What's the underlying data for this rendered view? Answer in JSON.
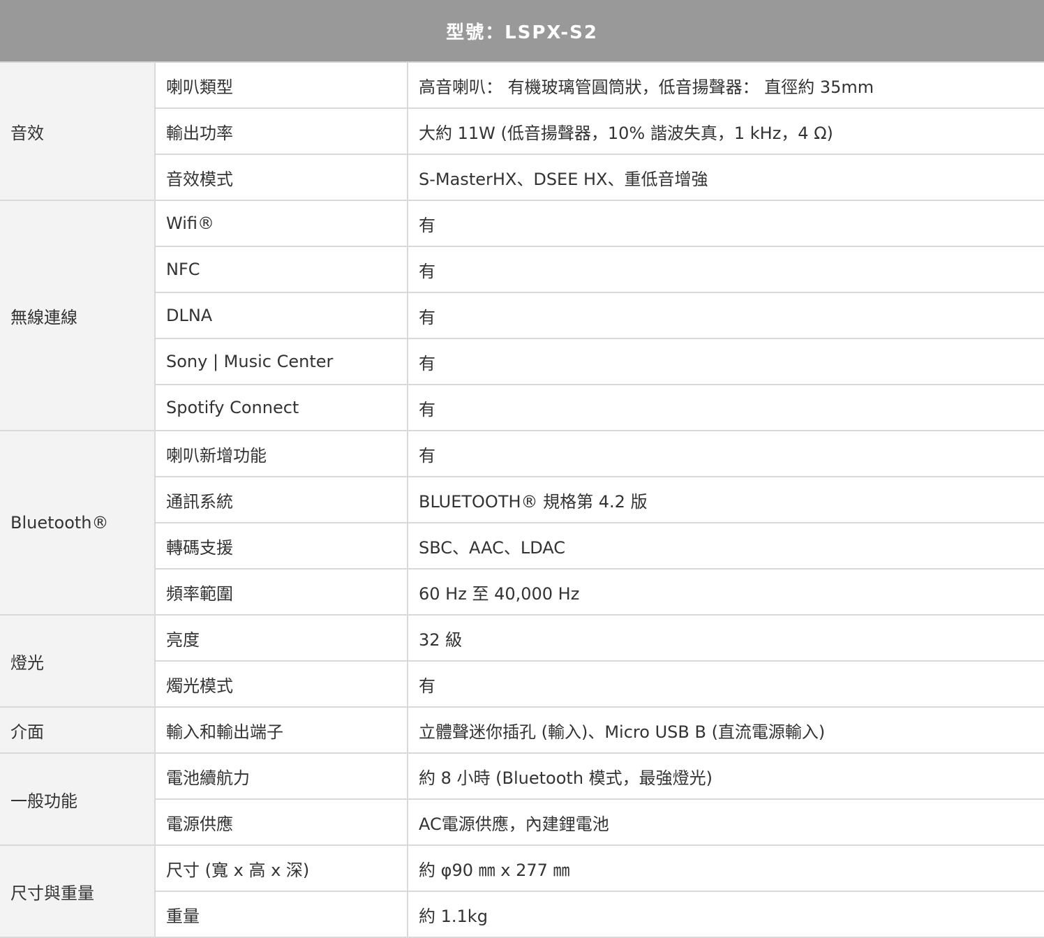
{
  "header": {
    "title": "型號：LSPX-S2"
  },
  "groups": [
    {
      "category": "音效",
      "rows": [
        {
          "item": "喇叭類型",
          "value": "高音喇叭： 有機玻璃管圓筒狀，低音揚聲器： 直徑約 35mm"
        },
        {
          "item": "輸出功率",
          "value": "大約 11W (低音揚聲器，10% 諧波失真，1 kHz，4 Ω)"
        },
        {
          "item": "音效模式",
          "value": "S-MasterHX、DSEE HX、重低音增強"
        }
      ]
    },
    {
      "category": "無線連線",
      "rows": [
        {
          "item": "Wifi®",
          "value": "有"
        },
        {
          "item": "NFC",
          "value": "有"
        },
        {
          "item": "DLNA",
          "value": "有"
        },
        {
          "item": "Sony | Music Center",
          "value": "有"
        },
        {
          "item": "Spotify Connect",
          "value": "有"
        }
      ]
    },
    {
      "category": "Bluetooth®",
      "rows": [
        {
          "item": "喇叭新增功能",
          "value": "有"
        },
        {
          "item": "通訊系統",
          "value": "BLUETOOTH® 規格第 4.2 版"
        },
        {
          "item": "轉碼支援",
          "value": "SBC、AAC、LDAC"
        },
        {
          "item": "頻率範圍",
          "value": "60 Hz 至 40,000 Hz"
        }
      ]
    },
    {
      "category": "燈光",
      "rows": [
        {
          "item": "亮度",
          "value": "32 級"
        },
        {
          "item": "燭光模式",
          "value": "有"
        }
      ]
    },
    {
      "category": "介面",
      "rows": [
        {
          "item": "輸入和輸出端子",
          "value": "立體聲迷你插孔 (輸入)、Micro USB B (直流電源輸入)"
        }
      ]
    },
    {
      "category": "一般功能",
      "rows": [
        {
          "item": "電池續航力",
          "value": "約 8 小時 (Bluetooth 模式，最強燈光)"
        },
        {
          "item": "電源供應",
          "value": "AC電源供應，內建鋰電池"
        }
      ]
    },
    {
      "category": "尺寸與重量",
      "rows": [
        {
          "item": "尺寸 (寬 x 高 x 深)",
          "value": "約 φ90 ㎜ x 277 ㎜"
        },
        {
          "item": "重量",
          "value": "約 1.1kg"
        }
      ]
    }
  ]
}
